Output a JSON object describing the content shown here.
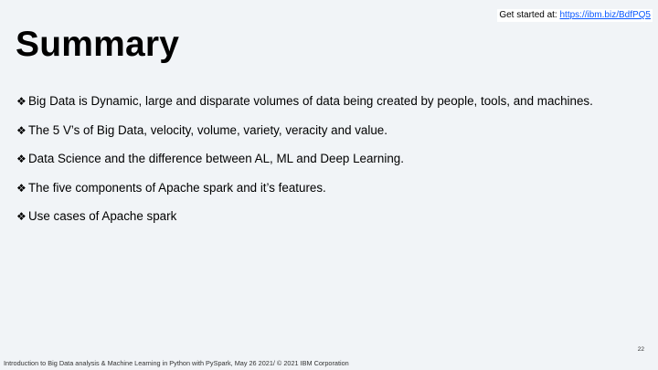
{
  "header": {
    "get_started_label": "Get started at:",
    "get_started_url": "https://ibm.biz/BdfPQ5"
  },
  "title": "Summary",
  "bullet_glyph": "❖",
  "bullets": [
    "Big Data is Dynamic, large and disparate volumes of data being created by people, tools, and machines.",
    "The 5 V’s of Big Data, velocity, volume, variety, veracity and value.",
    "Data Science and the difference between AL, ML and Deep Learning.",
    "The five components of Apache spark and it’s features.",
    "Use cases of Apache spark"
  ],
  "footer": "Introduction to Big Data analysis & Machine Learning in Python with PySpark, May 26 2021/ © 2021 IBM Corporation",
  "page_number": "22",
  "colors": {
    "background": "#f1f4f7",
    "link": "#0a58ff"
  }
}
